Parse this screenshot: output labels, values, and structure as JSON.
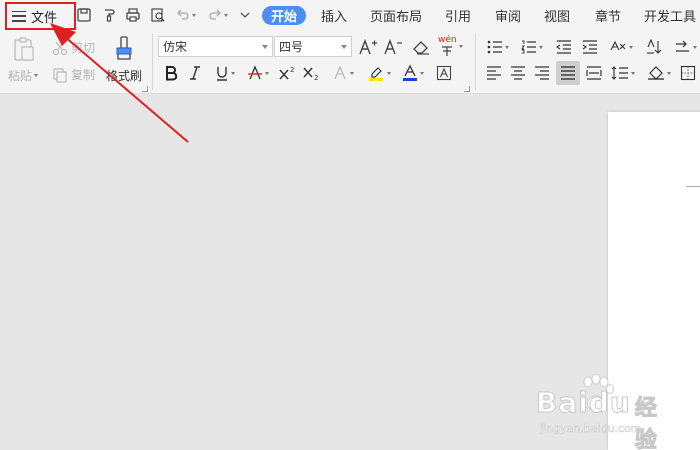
{
  "file_menu": {
    "label": "文件"
  },
  "quick_access": [
    {
      "icon": "save-icon"
    },
    {
      "icon": "format-painter-icon"
    },
    {
      "icon": "print-icon"
    },
    {
      "icon": "print-preview-icon"
    },
    {
      "icon": "undo-icon"
    },
    {
      "icon": "redo-icon"
    },
    {
      "icon": "customize-dropdown-icon"
    }
  ],
  "tabs": [
    {
      "label": "开始",
      "active": true
    },
    {
      "label": "插入"
    },
    {
      "label": "页面布局"
    },
    {
      "label": "引用"
    },
    {
      "label": "审阅"
    },
    {
      "label": "视图"
    },
    {
      "label": "章节"
    },
    {
      "label": "开发工具"
    }
  ],
  "clipboard": {
    "paste": "粘贴",
    "cut": "剪切",
    "copy": "复制",
    "format_painter": "格式刷"
  },
  "font": {
    "family": "仿宋",
    "size": "四号",
    "phonetic": "wén"
  },
  "watermark": {
    "brand": "Baidu",
    "brand_cn": "经验",
    "url": "jingyan.baidu.com"
  },
  "colors": {
    "accent": "#4d8ef6",
    "highlight_red": "#e02020",
    "font_color_red": "#e02020",
    "highlight_yellow": "#f5e800",
    "font_blue": "#1a3fd6"
  }
}
